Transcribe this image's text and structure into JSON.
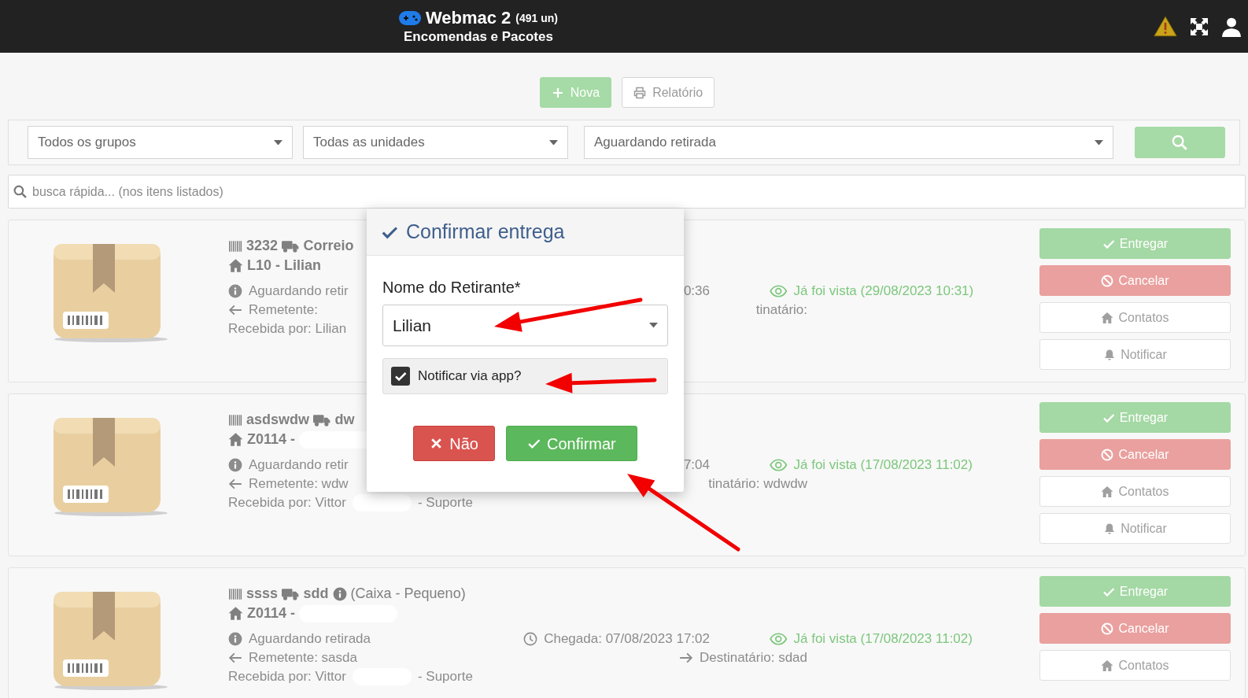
{
  "header": {
    "title": "Webmac 2",
    "count": "(491 un)",
    "subtitle": "Encomendas e Pacotes"
  },
  "actions": [
    {
      "label": "Nova",
      "kind": "new"
    },
    {
      "label": "Relatório",
      "kind": "report"
    }
  ],
  "filters": [
    {
      "value": "Todos os grupos",
      "kind": "group"
    },
    {
      "value": "Todas as unidades",
      "kind": "unit"
    },
    {
      "value": "Aguardando retirada",
      "kind": "status"
    }
  ],
  "quick_search": {
    "placeholder": "busca rápida... (nos itens listados)"
  },
  "packages": [
    {
      "title": [
        {
          "kind": "barcode",
          "text": "3232"
        },
        {
          "kind": "truck",
          "text": "Correio"
        }
      ],
      "unit": {
        "text": "L10 - Lilian",
        "redacted": false
      },
      "status": {
        "text": "Aguardando retir"
      },
      "arrival": {
        "kind": "clipped",
        "text": "0:36"
      },
      "seen": {
        "text": "Já foi vista (29/08/2023 10:31)"
      },
      "sender": {
        "text": "Remetente:"
      },
      "recipient": {
        "kind": "clipped",
        "text": "tinatário:"
      },
      "received": {
        "text": "Recebida por: Lilian",
        "redacted": false
      },
      "buttons": [
        {
          "label": "Entregar",
          "kind": "deliver"
        },
        {
          "label": "Cancelar",
          "kind": "cancel"
        },
        {
          "label": "Contatos",
          "kind": "contacts"
        },
        {
          "label": "Notificar",
          "kind": "notify"
        }
      ]
    },
    {
      "title": [
        {
          "kind": "barcode",
          "text": "asdswdw"
        },
        {
          "kind": "truck",
          "text": "dw"
        }
      ],
      "unit": {
        "text": "Z0114 -",
        "redacted": true
      },
      "status": {
        "text": "Aguardando retir"
      },
      "arrival": {
        "kind": "clipped",
        "text": "7:04"
      },
      "seen": {
        "text": "Já foi vista (17/08/2023 11:02)"
      },
      "sender": {
        "text": "Remetente: wdw"
      },
      "recipient": {
        "kind": "clipped",
        "text": "tinatário: wdwdw"
      },
      "received": {
        "text": "Recebida por: Vittor",
        "redacted": true,
        "suffix": "- Suporte"
      },
      "buttons": [
        {
          "label": "Entregar",
          "kind": "deliver"
        },
        {
          "label": "Cancelar",
          "kind": "cancel"
        },
        {
          "label": "Contatos",
          "kind": "contacts"
        },
        {
          "label": "Notificar",
          "kind": "notify"
        }
      ]
    },
    {
      "title": [
        {
          "kind": "barcode",
          "text": "ssss"
        },
        {
          "kind": "truck",
          "text": "sdd"
        },
        {
          "kind": "info",
          "text": "(Caixa - Pequeno)"
        }
      ],
      "unit": {
        "text": "Z0114 -",
        "redacted": true
      },
      "status": {
        "text": "Aguardando retirada"
      },
      "arrival": {
        "kind": "full",
        "text": "Chegada: 07/08/2023 17:02"
      },
      "seen": {
        "text": "Já foi vista (17/08/2023 11:02)"
      },
      "sender": {
        "text": "Remetente: sasda"
      },
      "recipient": {
        "kind": "full",
        "text": "Destinatário: sdad"
      },
      "received": {
        "text": "Recebida por: Vittor",
        "redacted": true,
        "suffix": "- Suporte"
      },
      "buttons": [
        {
          "label": "Entregar",
          "kind": "deliver"
        },
        {
          "label": "Cancelar",
          "kind": "cancel"
        },
        {
          "label": "Contatos",
          "kind": "contacts"
        }
      ]
    }
  ],
  "modal": {
    "title": "Confirmar entrega",
    "field_label": "Nome do Retirante*",
    "field_value": "Lilian",
    "notify": {
      "label": "Notificar via app?",
      "checked": true
    },
    "buttons": [
      {
        "label": "Não",
        "kind": "no"
      },
      {
        "label": "Confirmar",
        "kind": "confirm"
      }
    ]
  }
}
